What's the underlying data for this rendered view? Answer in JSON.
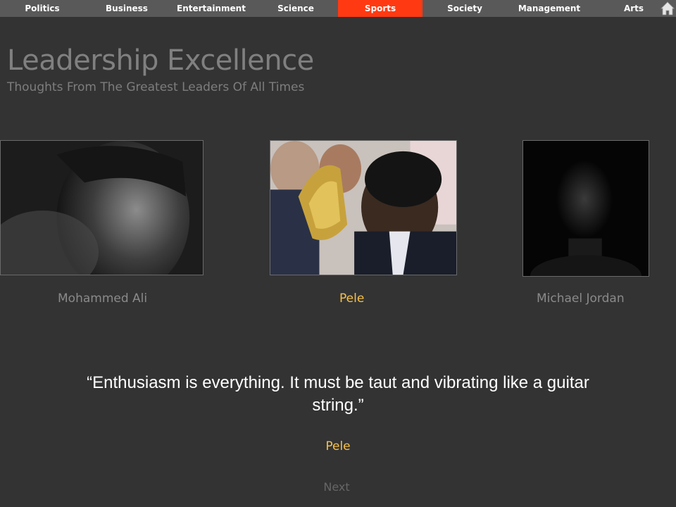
{
  "nav": {
    "items": [
      "Politics",
      "Business",
      "Entertainment",
      "Science",
      "Sports",
      "Society",
      "Management",
      "Arts"
    ],
    "active": "Sports",
    "home_icon": "home-icon"
  },
  "header": {
    "title": "Leadership Excellence",
    "subtitle": "Thoughts From The Greatest Leaders Of All Times"
  },
  "leaders": [
    {
      "name": "Mohammed Ali",
      "photo": "portrait-photo",
      "selected": false
    },
    {
      "name": "Pele",
      "photo": "portrait-photo",
      "selected": true
    },
    {
      "name": "Michael Jordan",
      "photo": "portrait-photo",
      "selected": false
    }
  ],
  "quote": {
    "text": "“Enthusiasm is everything. It must be taut and vibrating like a guitar string.”",
    "author": "Pele"
  },
  "next_label": "Next",
  "colors": {
    "background": "#333333",
    "nav_bar": "#595959",
    "nav_active": "#ff3a12",
    "highlight": "#f7c14a"
  }
}
